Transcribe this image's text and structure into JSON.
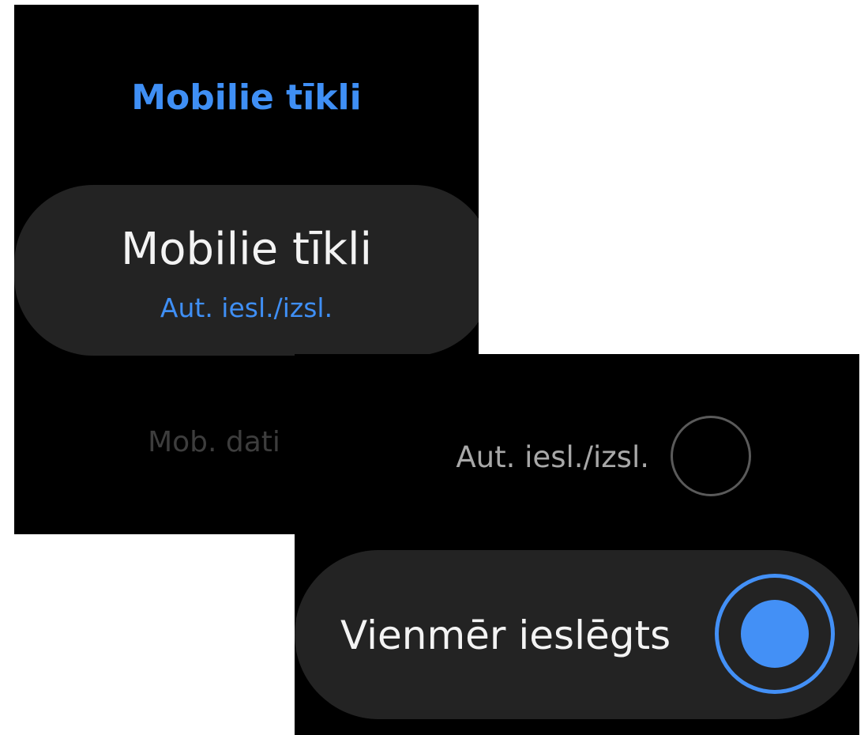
{
  "screen_a": {
    "page_title": "Mobilie tīkli",
    "menu_item": {
      "title": "Mobilie tīkli",
      "subtitle": "Aut. iesl./izsl."
    },
    "next_item": "Mob. dati"
  },
  "screen_b": {
    "options": [
      {
        "label": "Aut. iesl./izsl.",
        "selected": false
      },
      {
        "label": "Vienmēr ieslēgts",
        "selected": true
      }
    ]
  },
  "colors": {
    "accent": "#3f8ff5",
    "background": "#000000",
    "card": "#232323"
  }
}
